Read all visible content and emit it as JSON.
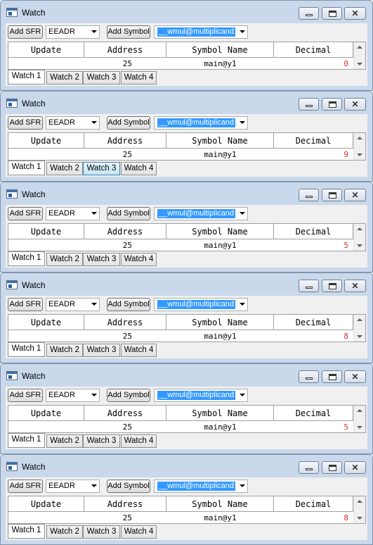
{
  "windows": [
    {
      "title": "Watch",
      "add_sfr_label": "Add SFR",
      "sfr_combo_value": "EEADR",
      "add_symbol_label": "Add Symbol",
      "symbol_combo_value": "__wmul@multiplicand",
      "columns": [
        "Update",
        "Address",
        "Symbol Name",
        "Decimal"
      ],
      "row": {
        "address": "25",
        "symbol": "main@y1",
        "decimal": "0"
      },
      "tabs": [
        "Watch 1",
        "Watch 2",
        "Watch 3",
        "Watch 4"
      ],
      "active_tab": "Watch 1",
      "hover_tab": ""
    },
    {
      "title": "Watch",
      "add_sfr_label": "Add SFR",
      "sfr_combo_value": "EEADR",
      "add_symbol_label": "Add Symbol",
      "symbol_combo_value": "__wmul@multiplicand",
      "columns": [
        "Update",
        "Address",
        "Symbol Name",
        "Decimal"
      ],
      "row": {
        "address": "25",
        "symbol": "main@y1",
        "decimal": "9"
      },
      "tabs": [
        "Watch 1",
        "Watch 2",
        "Watch 3",
        "Watch 4"
      ],
      "active_tab": "Watch 1",
      "hover_tab": "Watch 3"
    },
    {
      "title": "Watch",
      "add_sfr_label": "Add SFR",
      "sfr_combo_value": "EEADR",
      "add_symbol_label": "Add Symbol",
      "symbol_combo_value": "__wmul@multiplicand",
      "columns": [
        "Update",
        "Address",
        "Symbol Name",
        "Decimal"
      ],
      "row": {
        "address": "25",
        "symbol": "main@y1",
        "decimal": "5"
      },
      "tabs": [
        "Watch 1",
        "Watch 2",
        "Watch 3",
        "Watch 4"
      ],
      "active_tab": "Watch 1",
      "hover_tab": ""
    },
    {
      "title": "Watch",
      "add_sfr_label": "Add SFR",
      "sfr_combo_value": "EEADR",
      "add_symbol_label": "Add Symbol",
      "symbol_combo_value": "__wmul@multiplicand",
      "columns": [
        "Update",
        "Address",
        "Symbol Name",
        "Decimal"
      ],
      "row": {
        "address": "25",
        "symbol": "main@y1",
        "decimal": "8"
      },
      "tabs": [
        "Watch 1",
        "Watch 2",
        "Watch 3",
        "Watch 4"
      ],
      "active_tab": "Watch 1",
      "hover_tab": ""
    },
    {
      "title": "Watch",
      "add_sfr_label": "Add SFR",
      "sfr_combo_value": "EEADR",
      "add_symbol_label": "Add Symbol",
      "symbol_combo_value": "__wmul@multiplicand",
      "columns": [
        "Update",
        "Address",
        "Symbol Name",
        "Decimal"
      ],
      "row": {
        "address": "25",
        "symbol": "main@y1",
        "decimal": "5"
      },
      "tabs": [
        "Watch 1",
        "Watch 2",
        "Watch 3",
        "Watch 4"
      ],
      "active_tab": "Watch 1",
      "hover_tab": ""
    },
    {
      "title": "Watch",
      "add_sfr_label": "Add SFR",
      "sfr_combo_value": "EEADR",
      "add_symbol_label": "Add Symbol",
      "symbol_combo_value": "__wmul@multiplicand",
      "columns": [
        "Update",
        "Address",
        "Symbol Name",
        "Decimal"
      ],
      "row": {
        "address": "25",
        "symbol": "main@y1",
        "decimal": "8"
      },
      "tabs": [
        "Watch 1",
        "Watch 2",
        "Watch 3",
        "Watch 4"
      ],
      "active_tab": "Watch 1",
      "hover_tab": ""
    }
  ],
  "colors": {
    "title_bar": "#c9d8ea",
    "selection": "#3399ff",
    "value_changed": "#d0302a"
  },
  "icons": {
    "app": "watch-window-icon",
    "minimize": "minimize-icon",
    "maximize": "maximize-icon",
    "close": "close-icon"
  }
}
